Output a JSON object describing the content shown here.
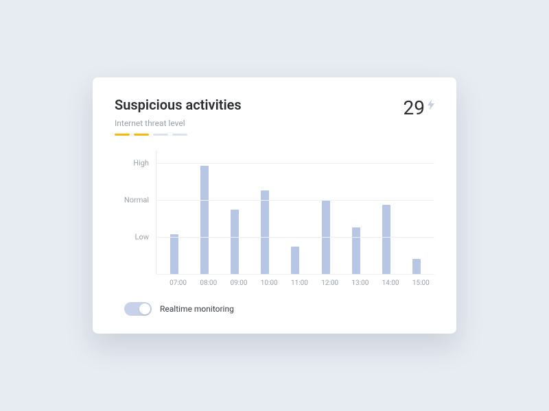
{
  "card": {
    "title": "Suspicious activities",
    "subtitle": "Internet threat level",
    "count": "29",
    "threat_segments_active": 2,
    "threat_segments_total": 4,
    "toggle_label": "Realtime monitoring",
    "toggle_on": true
  },
  "chart_data": {
    "type": "bar",
    "categories": [
      "07:00",
      "08:00",
      "09:00",
      "10:00",
      "11:00",
      "12:00",
      "13:00",
      "14:00",
      "15:00"
    ],
    "values": [
      32,
      88,
      52,
      68,
      22,
      60,
      38,
      56,
      12
    ],
    "ylabel_ticks": [
      {
        "label": "High",
        "value": 90
      },
      {
        "label": "Normal",
        "value": 60
      },
      {
        "label": "Low",
        "value": 30
      }
    ],
    "ylim": [
      0,
      100
    ],
    "title": "Suspicious activities",
    "xlabel": "",
    "ylabel": ""
  }
}
